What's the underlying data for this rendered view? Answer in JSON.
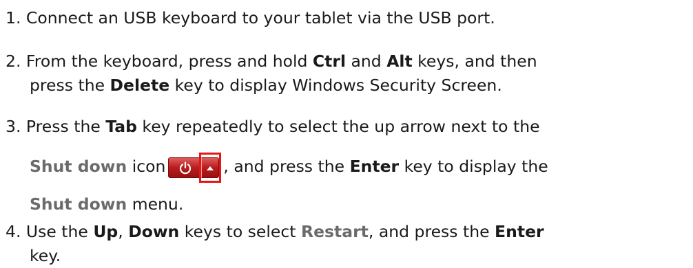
{
  "steps": [
    {
      "num": "1.",
      "text": "Connect an USB keyboard to your tablet via the USB port."
    },
    {
      "num": "2.",
      "l1_a": "From the keyboard, press and hold ",
      "l1_b": "Ctrl",
      "l1_c": " and ",
      "l1_d": "Alt",
      "l1_e": " keys, and then",
      "l2_a": "press the ",
      "l2_b": "Delete",
      "l2_c": " key to display Windows Security Screen."
    },
    {
      "num": "3.",
      "l1_a": "Press the ",
      "l1_b": "Tab",
      "l1_c": " key repeatedly to select the up arrow next to the",
      "l2_a": "Shut down",
      "l2_b": " icon",
      "l2_c": ", and press the ",
      "l2_d": "Enter",
      "l2_e": " key to display the",
      "l3_a": "Shut down",
      "l3_b": " menu."
    },
    {
      "num": "4.",
      "l1_a": "Use the ",
      "l1_b": "Up",
      "l1_c": ", ",
      "l1_d": "Down",
      "l1_e": " keys to select ",
      "l1_f": "Restart",
      "l1_g": ", and press the ",
      "l1_h": "Enter",
      "l2_a": "key."
    }
  ],
  "icons": {
    "power": "power-icon",
    "arrow": "up-arrow-icon",
    "highlight_color": "#e51515",
    "button_color": "#b81d1d"
  }
}
